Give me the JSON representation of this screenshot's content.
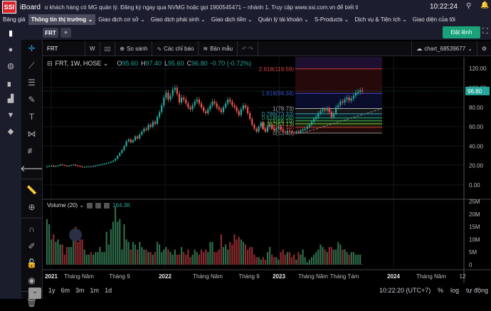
{
  "topbar": {
    "logo": "SSI",
    "app": "iBoard",
    "ticker": "o khách hàng có MG quản lý. Đăng ký ngay qua NVMG hoặc gọi 1900545471 – nhánh 1. Truy cập www.ssi.com.vn để biết thêm chi tiết",
    "clock": "10:22:24"
  },
  "menu": [
    {
      "label": "Bảng giá"
    },
    {
      "label": "Thông tin thị trường ⌄",
      "active": true
    },
    {
      "label": "Giao dịch cơ sở ⌄"
    },
    {
      "label": "Giao dịch phái sinh ⌄"
    },
    {
      "label": "Giao dịch tiền ⌄"
    },
    {
      "label": "Quản lý tài khoản ⌄"
    },
    {
      "label": "S-Products ⌄"
    },
    {
      "label": "Dịch vụ & Tiện ích ⌄"
    },
    {
      "label": "Giao diện của tôi"
    }
  ],
  "tabs": {
    "active": "FRT",
    "add": "+",
    "order_button": "Đặt lệnh"
  },
  "toolbar": {
    "symbol": "FRT",
    "interval": "W",
    "compare": "So sánh",
    "indicators": "Các chỉ báo",
    "templates": "Bản mẫu",
    "chart_name": "chart_68539677"
  },
  "legend": {
    "title": "FRT, 1W, HOSE ⌄",
    "o_label": "O",
    "o": "95.60",
    "h_label": "H",
    "h": "97.40",
    "l_label": "L",
    "l": "95.60",
    "c_label": "C",
    "c": "96.80",
    "change": "-0.70 (-0.72%)"
  },
  "volume": {
    "label": "Volume (20) ⌄",
    "value": "164.3K"
  },
  "last_price": "96.80",
  "colors": {
    "up": "#26a69a",
    "down": "#ef5350",
    "accent": "#1aa37a",
    "vol_up": "#2e6b4a",
    "vol_down": "#8b2a2e"
  },
  "chart_data": {
    "type": "candlestick",
    "interval": "1W",
    "start": "2021-01-04",
    "price_ticks": [
      "120.00",
      "100.00",
      "80.00",
      "60.00",
      "40.00",
      "20.00",
      "0.00"
    ],
    "volume_ticks": [
      "25M",
      "20M",
      "15M",
      "10M",
      "5M",
      "0"
    ],
    "time_ticks": [
      "2021",
      "Tháng Năm",
      "Tháng 9",
      "2022",
      "Tháng Năm",
      "Tháng 9",
      "2023",
      "Tháng Năm",
      "Tháng Tám",
      "2024",
      "Tháng Năm",
      "12"
    ],
    "close": [
      19,
      19.5,
      20,
      19,
      19.5,
      20,
      21,
      20.5,
      20,
      19.5,
      20,
      20.5,
      21,
      20,
      19.5,
      19,
      18.5,
      18.5,
      19,
      19,
      18.8,
      19.5,
      20,
      20.5,
      21,
      21.5,
      22,
      22.5,
      23,
      24,
      25,
      27,
      30,
      33,
      36,
      40,
      45,
      47,
      44,
      46,
      50,
      48,
      52,
      55,
      58,
      57,
      62,
      60,
      65,
      63,
      70,
      75,
      82,
      90,
      95,
      88,
      92,
      98,
      100,
      94,
      85,
      90,
      88,
      84,
      80,
      78,
      82,
      86,
      88,
      84,
      80,
      76,
      74,
      78,
      82,
      86,
      84,
      80,
      78,
      75,
      80,
      84,
      88,
      86,
      82,
      80,
      76,
      72,
      78,
      82,
      80,
      74,
      68,
      62,
      58,
      55,
      60,
      64,
      58,
      55,
      60,
      62,
      58,
      56,
      58,
      60,
      57,
      55,
      54,
      56,
      55,
      54,
      53.5,
      55,
      54,
      56,
      57,
      58,
      60,
      62,
      65,
      68,
      70,
      74,
      76,
      78,
      77,
      79,
      75,
      70,
      74,
      80,
      82,
      86,
      85,
      88,
      90,
      87,
      89,
      92,
      95,
      96,
      97.5,
      96.8
    ],
    "volume_m": [
      18,
      16,
      10,
      12,
      9,
      10,
      8,
      8,
      4,
      7,
      7,
      7,
      12,
      15,
      9,
      10,
      10,
      6,
      4,
      4,
      5,
      4,
      5,
      5,
      7,
      5,
      5,
      13,
      8,
      14,
      17,
      23,
      17,
      18,
      6,
      16,
      10,
      9,
      6,
      9,
      8,
      6,
      9,
      7,
      6,
      6,
      5,
      5,
      4,
      5,
      9,
      8,
      5,
      6,
      7,
      6,
      5,
      4,
      6,
      4,
      4,
      7,
      5,
      4,
      6,
      3,
      4,
      6,
      5,
      4,
      6,
      5,
      6,
      5,
      9,
      9,
      5,
      5,
      6,
      12,
      7,
      8,
      6,
      9,
      8,
      12,
      10,
      11,
      10,
      9,
      8,
      6,
      7,
      7,
      4,
      3,
      3,
      2,
      3,
      2,
      5,
      7,
      4,
      3,
      3,
      2,
      5,
      6,
      4,
      5,
      5,
      3,
      4,
      2,
      5,
      4,
      6,
      3,
      1,
      2,
      3,
      4,
      5,
      6,
      8,
      7,
      6,
      5,
      7,
      7,
      6,
      6,
      9,
      8,
      6,
      6,
      5,
      4,
      5,
      5,
      4,
      4,
      4,
      0.16
    ],
    "fibonacci": [
      {
        "label": "2.618(119.59)",
        "price": 119.59,
        "color": "#d03a3a"
      },
      {
        "label": "1.618(94.34)",
        "price": 94.34,
        "color": "#3a4fd0"
      },
      {
        "label": "1(78.73)",
        "price": 78.73,
        "color": "#aaaaaa"
      },
      {
        "label": "0.786(73.33)",
        "price": 73.33,
        "color": "#3aa0c0"
      },
      {
        "label": "0.618(69.08)",
        "price": 69.08,
        "color": "#2ea080"
      },
      {
        "label": "0.5(66.10)",
        "price": 66.1,
        "color": "#4caf50"
      },
      {
        "label": "0.382(63.13)",
        "price": 63.13,
        "color": "#8bc34a"
      },
      {
        "label": "0.236(59.44)",
        "price": 59.44,
        "color": "#d03a3a"
      },
      {
        "label": "0(53.48)",
        "price": 53.48,
        "color": "#888888"
      }
    ]
  },
  "bottom": {
    "ranges": [
      "1y",
      "6m",
      "3m",
      "1m",
      "1d"
    ],
    "time": "10:22:20 (UTC+7)",
    "pct": "%",
    "log": "log",
    "auto": "tự động"
  }
}
